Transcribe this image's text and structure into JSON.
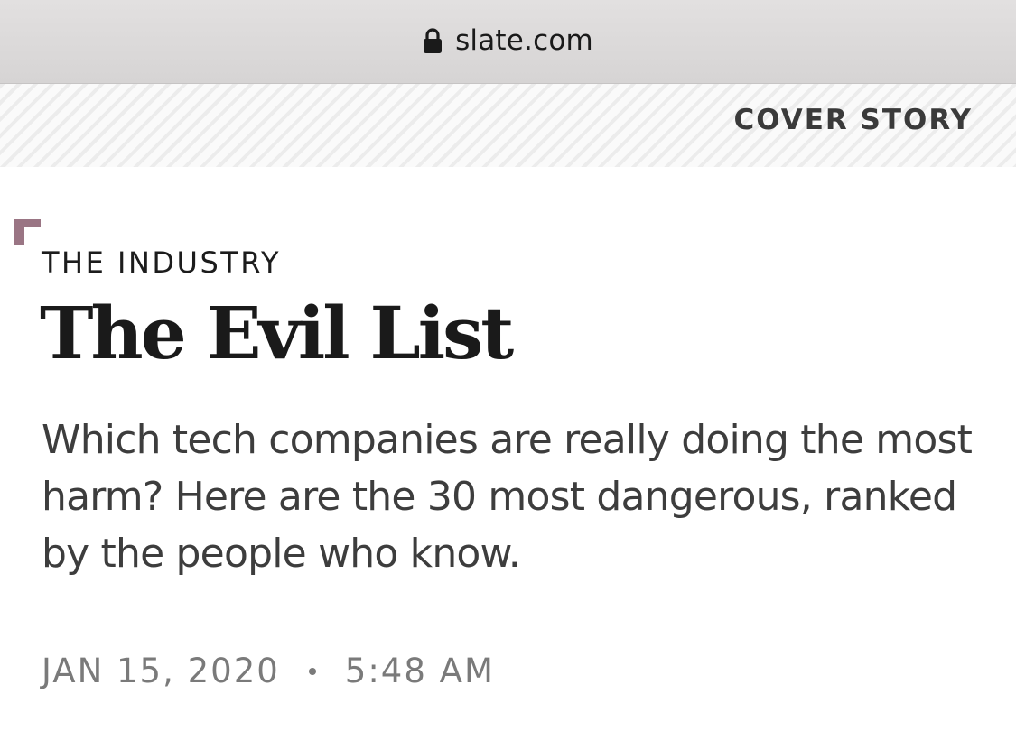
{
  "browser": {
    "url": "slate.com",
    "lock_icon": "lock-icon"
  },
  "section": {
    "label": "COVER STORY"
  },
  "article": {
    "kicker": "THE INDUSTRY",
    "headline": "The Evil List",
    "dek": "Which tech companies are really doing the most harm? Here are the 30 most dangerous, ranked by the people who know.",
    "date": "JAN 15, 2020",
    "time": "5:48 AM"
  },
  "colors": {
    "accent": "#9a7584",
    "url_bar_bg": "#dcdada",
    "headline": "#1a1a1a",
    "dek": "#3d3d3d",
    "meta": "#7a7a7a"
  }
}
